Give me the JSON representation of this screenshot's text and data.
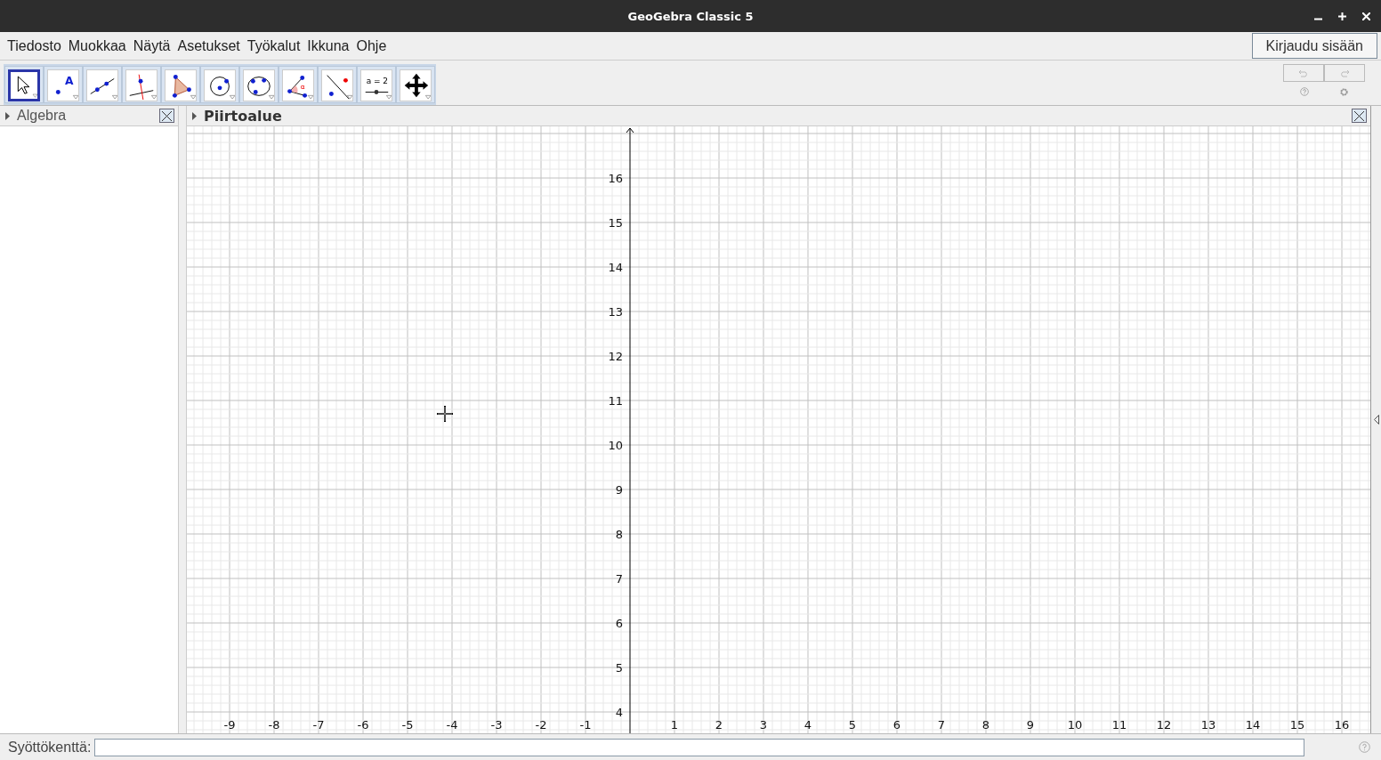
{
  "window": {
    "title": "GeoGebra Classic 5"
  },
  "menu": [
    "Tiedosto",
    "Muokkaa",
    "Näytä",
    "Asetukset",
    "Työkalut",
    "Ikkuna",
    "Ohje"
  ],
  "login_button": "Kirjaudu sisään",
  "tools": [
    {
      "kind": "move",
      "selected": true
    },
    {
      "kind": "point",
      "label": "A",
      "selected": false
    },
    {
      "kind": "line",
      "selected": false
    },
    {
      "kind": "perpendicular",
      "selected": false
    },
    {
      "kind": "polygon",
      "selected": false
    },
    {
      "kind": "circle",
      "selected": false
    },
    {
      "kind": "conic",
      "selected": false
    },
    {
      "kind": "angle",
      "label": "α",
      "selected": false
    },
    {
      "kind": "reflect",
      "selected": false
    },
    {
      "kind": "slider",
      "label": "a = 2",
      "selected": false
    },
    {
      "kind": "pan",
      "selected": false
    }
  ],
  "algebra_panel": {
    "title": "Algebra"
  },
  "graphics_panel": {
    "title": "Piirtoalue",
    "x_ticks_negative": [
      "-9",
      "-8",
      "-7",
      "-6",
      "-5",
      "-4",
      "-3",
      "-2",
      "-1"
    ],
    "x_ticks_positive": [
      "1",
      "2",
      "3",
      "4",
      "5",
      "6",
      "7",
      "8",
      "9",
      "10",
      "11",
      "12",
      "13",
      "14",
      "15",
      "16"
    ],
    "y_ticks": [
      "16",
      "15",
      "14",
      "13",
      "12",
      "11",
      "10",
      "9",
      "8",
      "7",
      "6",
      "5",
      "4"
    ]
  },
  "input_bar": {
    "label": "Syöttökenttä:"
  }
}
